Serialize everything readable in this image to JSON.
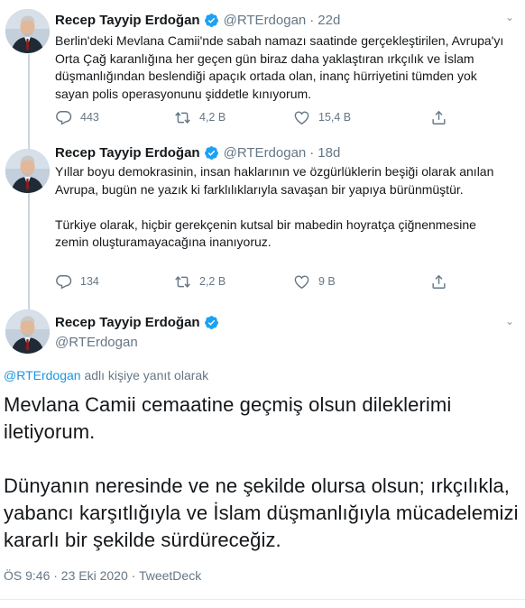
{
  "tweets": [
    {
      "name": "Recep Tayyip Erdoğan",
      "handle": "@RTErdogan",
      "dot": "·",
      "time": "22d",
      "paragraphs": [
        "Berlin'deki Mevlana Camii'nde sabah namazı saatinde gerçekleştirilen, Avrupa'yı Orta Çağ karanlığına her geçen gün biraz daha yaklaştıran ırkçılık ve İslam düşmanlığından beslendiği apaçık ortada olan, inanç hürriyetini tümden yok sayan polis operasyonunu şiddetle kınıyorum."
      ],
      "replies": "443",
      "retweets": "4,2 B",
      "likes": "15,4 B"
    },
    {
      "name": "Recep Tayyip Erdoğan",
      "handle": "@RTErdogan",
      "dot": "·",
      "time": "18d",
      "paragraphs": [
        "Yıllar boyu demokrasinin, insan haklarının ve özgürlüklerin beşiği olarak anılan Avrupa, bugün ne yazık ki farklılıklarıyla savaşan bir yapıya bürünmüştür.",
        "Türkiye olarak, hiçbir gerekçenin kutsal bir mabedin hoyratça çiğnenmesine zemin oluşturamayacağına inanıyoruz."
      ],
      "replies": "134",
      "retweets": "2,2 B",
      "likes": "9 B"
    }
  ],
  "main": {
    "name": "Recep Tayyip Erdoğan",
    "handle": "@RTErdogan",
    "replying_mention": "@RTErdogan",
    "replying_suffix": " adlı kişiye yanıt olarak",
    "paragraphs": [
      "Mevlana Camii cemaatine geçmiş olsun dileklerimi iletiyorum.",
      "Dünyanın neresinde ve ne şekilde olursa olsun; ırkçılıkla, yabancı karşıtlığıyla ve İslam düşmanlığıyla mücadelemizi kararlı bir şekilde sürdüreceğiz."
    ],
    "meta": "ÖS 9:46 · 23 Eki 2020 · TweetDeck"
  },
  "colors": {
    "accent": "#1da1f2",
    "muted": "#657786",
    "text": "#14171a",
    "line": "#ccd6dd"
  },
  "icons": [
    "reply-icon",
    "retweet-icon",
    "like-icon",
    "share-icon",
    "verified-badge-icon",
    "caret-down-icon"
  ]
}
